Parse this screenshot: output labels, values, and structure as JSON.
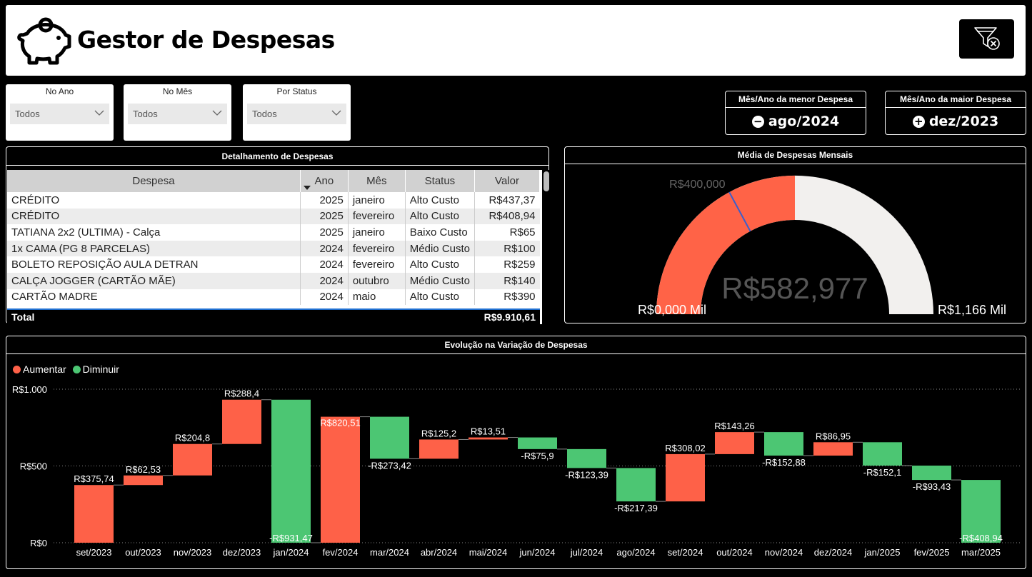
{
  "header": {
    "title": "Gestor de Despesas"
  },
  "slicers": [
    {
      "label": "No Ano",
      "value": "Todos"
    },
    {
      "label": "No Mês",
      "value": "Todos"
    },
    {
      "label": "Por Status",
      "value": "Todos"
    }
  ],
  "kpis": {
    "lowest": {
      "label": "Mês/Ano da menor Despesa",
      "icon": "−",
      "value": "ago/2024"
    },
    "highest": {
      "label": "Mês/Ano da maior Despesa",
      "icon": "+",
      "value": "dez/2023"
    }
  },
  "table": {
    "title": "Detalhamento de Despesas",
    "columns": [
      "Despesa",
      "Ano",
      "Mês",
      "Status",
      "Valor"
    ],
    "rows": [
      [
        "CRÉDITO",
        "2025",
        "janeiro",
        "Alto Custo",
        "R$437,37"
      ],
      [
        "CRÉDITO",
        "2025",
        "fevereiro",
        "Alto Custo",
        "R$408,94"
      ],
      [
        "TATIANA 2x2 (ULTIMA) - Calça",
        "2025",
        "janeiro",
        "Baixo Custo",
        "R$65"
      ],
      [
        "1x CAMA (PG 8 PARCELAS)",
        "2024",
        "fevereiro",
        "Médio Custo",
        "R$100"
      ],
      [
        "BOLETO REPOSIÇÃO AULA DETRAN",
        "2024",
        "fevereiro",
        "Alto Custo",
        "R$259"
      ],
      [
        "CALÇA JOGGER (CARTÃO MÃE)",
        "2024",
        "outubro",
        "Médio Custo",
        "R$140"
      ],
      [
        "CARTÃO MADRE",
        "2024",
        "maio",
        "Alto Custo",
        "R$390"
      ]
    ],
    "total_label": "Total",
    "total_value": "R$9.910,61"
  },
  "gauge": {
    "title": "Média de Despesas Mensais",
    "value": 582977,
    "value_label": "R$582,977",
    "min": 0,
    "max": 1166000,
    "min_label": "R$0,000 Mil",
    "max_label": "R$1,166 Mil",
    "target": 400000,
    "target_label": "R$400,000",
    "fill_color": "#ff6347",
    "track_color": "#f2f0ee",
    "target_color": "#3a5fcd"
  },
  "chart_data": {
    "type": "waterfall",
    "title": "Evolução na Variação de Despesas",
    "legend": [
      {
        "name": "Aumentar",
        "color": "#fe6148"
      },
      {
        "name": "Diminuir",
        "color": "#4cc673"
      }
    ],
    "legend_position": "top-left",
    "ylim": [
      0,
      1000
    ],
    "yticks": [
      0,
      500,
      1000
    ],
    "ytick_labels": [
      "R$0",
      "R$500",
      "R$1.000"
    ],
    "grid": true,
    "categories": [
      "set/2023",
      "out/2023",
      "nov/2023",
      "dez/2023",
      "jan/2024",
      "fev/2024",
      "mar/2024",
      "abr/2024",
      "mai/2024",
      "jun/2024",
      "jul/2024",
      "ago/2024",
      "set/2024",
      "out/2024",
      "nov/2024",
      "dez/2024",
      "jan/2025",
      "fev/2025",
      "mar/2025"
    ],
    "values": [
      375.74,
      62.53,
      204.8,
      288.4,
      -931.47,
      820.51,
      -273.42,
      125.2,
      13.51,
      -75.9,
      -123.39,
      -217.39,
      308.02,
      143.26,
      -152.88,
      86.95,
      -152.1,
      -93.43,
      -408.94
    ],
    "labels": [
      "R$375,74",
      "R$62,53",
      "R$204,8",
      "R$288,4",
      "-R$931,47",
      "R$820,51",
      "-R$273,42",
      "R$125,2",
      "R$13,51",
      "-R$75,9",
      "-R$123,39",
      "-R$217,39",
      "R$308,02",
      "R$143,26",
      "-R$152,88",
      "R$86,95",
      "-R$152,1",
      "-R$93,43",
      "-R$408,94"
    ]
  }
}
